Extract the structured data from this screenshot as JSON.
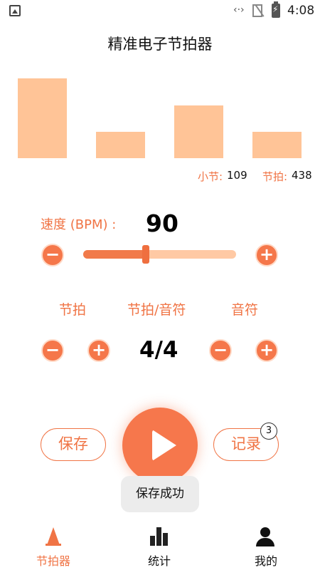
{
  "status_bar": {
    "time": "4:08",
    "network": "‹·›"
  },
  "app": {
    "title": "精准电子节拍器"
  },
  "beat_bars": {
    "levels": [
      1.0,
      0.33,
      0.66,
      0.33
    ],
    "color": "#ffc497"
  },
  "counts": {
    "measure_label": "小节:",
    "measure_value": "109",
    "beat_label": "节拍:",
    "beat_value": "438"
  },
  "tempo": {
    "label": "速度 (BPM) :",
    "value": "90",
    "slider_fraction": 0.42,
    "minus": "−",
    "plus": "+"
  },
  "beat_settings": {
    "col1": "节拍",
    "col2": "节拍/音符",
    "col3": "音符",
    "time_signature": "4/4",
    "minus": "−",
    "plus": "+"
  },
  "actions": {
    "save_label": "保存",
    "record_label": "记录",
    "record_badge": "3"
  },
  "toast": {
    "message": "保存成功"
  },
  "bottom_nav": {
    "items": [
      {
        "label": "节拍器",
        "icon": "metronome-icon",
        "active": true
      },
      {
        "label": "统计",
        "icon": "bar-chart-icon",
        "active": false
      },
      {
        "label": "我的",
        "icon": "person-icon",
        "active": false
      }
    ]
  },
  "colors": {
    "accent": "#f07445",
    "accent_light": "#ffc497"
  }
}
